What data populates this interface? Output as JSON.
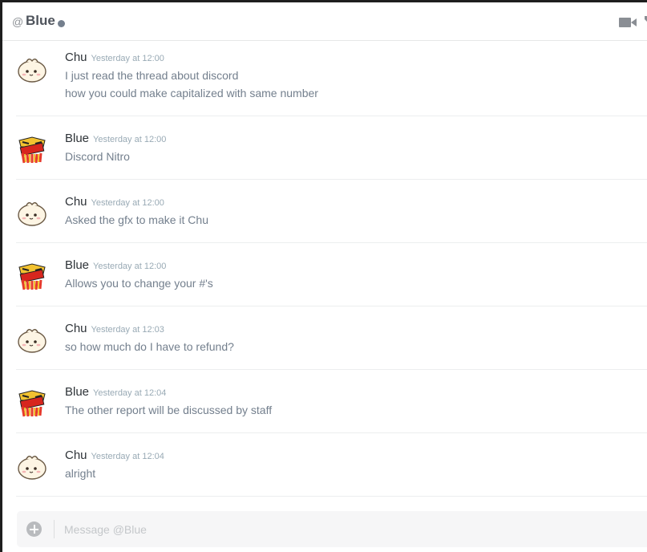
{
  "header": {
    "at_symbol": "@",
    "channel_name": "Blue",
    "status_color": "#747f8d",
    "video_icon": "video-camera-icon"
  },
  "messages": [
    {
      "author": "Chu",
      "timestamp": "Yesterday at 12:00",
      "avatar": "chu-dumpling-avatar",
      "lines": [
        "I just read the thread about discord",
        "how you could make capitalized with same number"
      ]
    },
    {
      "author": "Blue",
      "timestamp": "Yesterday at 12:00",
      "avatar": "blue-monster-avatar",
      "lines": [
        "Discord Nitro"
      ]
    },
    {
      "author": "Chu",
      "timestamp": "Yesterday at 12:00",
      "avatar": "chu-dumpling-avatar",
      "lines": [
        "Asked the gfx to make it Chu"
      ]
    },
    {
      "author": "Blue",
      "timestamp": "Yesterday at 12:00",
      "avatar": "blue-monster-avatar",
      "lines": [
        "Allows you to change your #'s"
      ]
    },
    {
      "author": "Chu",
      "timestamp": "Yesterday at 12:03",
      "avatar": "chu-dumpling-avatar",
      "lines": [
        "so how much do I have to refund?"
      ]
    },
    {
      "author": "Blue",
      "timestamp": "Yesterday at 12:04",
      "avatar": "blue-monster-avatar",
      "lines": [
        "The other report will be discussed by staff"
      ]
    },
    {
      "author": "Chu",
      "timestamp": "Yesterday at 12:04",
      "avatar": "chu-dumpling-avatar",
      "lines": [
        "alright"
      ]
    }
  ],
  "composer": {
    "placeholder": "Message @Blue",
    "add_icon": "plus-circle-icon"
  }
}
